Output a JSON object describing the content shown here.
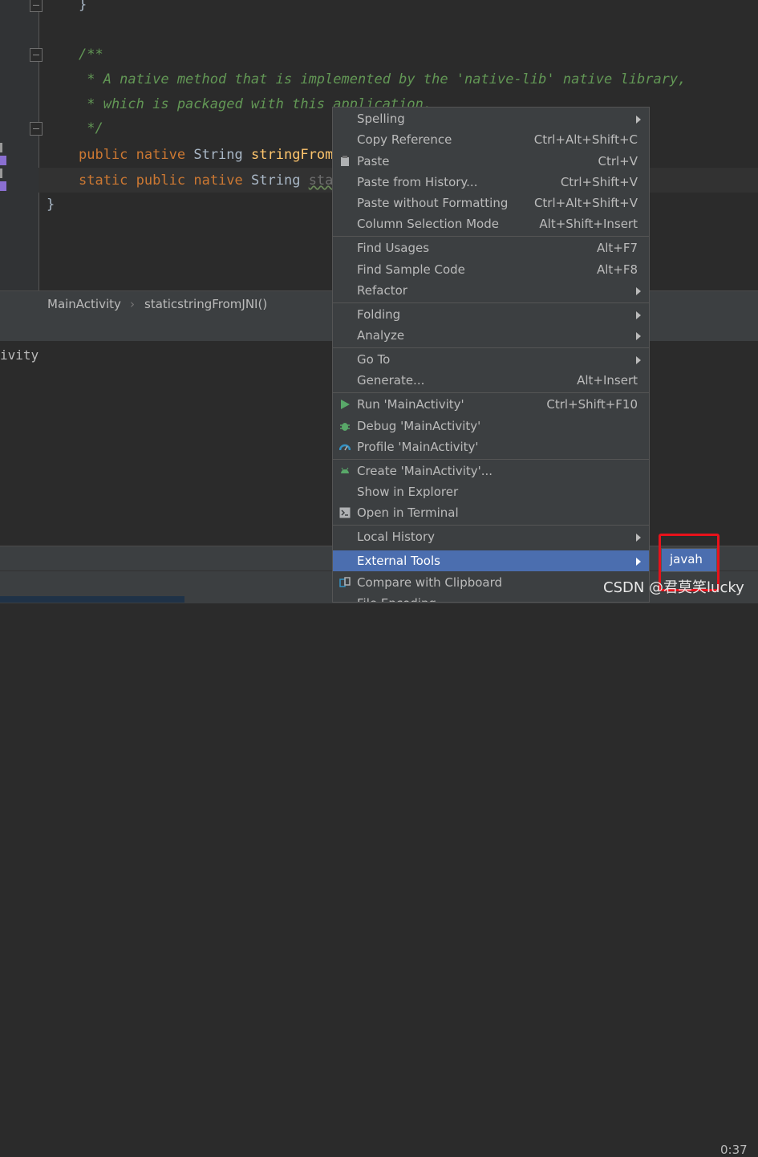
{
  "editor": {
    "line_brace_top": "}",
    "comment_open": "/**",
    "comment_line1": " * A native method that is implemented by the 'native-lib' native library,",
    "comment_line2": " * which is packaged with this application.",
    "comment_close": " */",
    "line1": {
      "kw1": "public",
      "kw2": "native",
      "type": "String",
      "method": "stringFromJ"
    },
    "line2": {
      "kw1": "static",
      "kw2": "public",
      "kw3": "native",
      "type": "String",
      "method": "stat"
    },
    "closing_brace": "}"
  },
  "breadcrumb": {
    "class_name": "MainActivity",
    "separator": "›",
    "method_name": "staticstringFromJNI()"
  },
  "panel": {
    "text_fragment": "ivity"
  },
  "context_menu": {
    "items": [
      {
        "label": "Spelling",
        "shortcut": "",
        "submenu": true
      },
      {
        "label": "Copy Reference",
        "shortcut": "Ctrl+Alt+Shift+C"
      },
      {
        "label": "Paste",
        "shortcut": "Ctrl+V",
        "icon": "paste-icon"
      },
      {
        "label": "Paste from History...",
        "shortcut": "Ctrl+Shift+V"
      },
      {
        "label": "Paste without Formatting",
        "shortcut": "Ctrl+Alt+Shift+V"
      },
      {
        "label": "Column Selection Mode",
        "shortcut": "Alt+Shift+Insert"
      },
      {
        "label": "Find Usages",
        "shortcut": "Alt+F7"
      },
      {
        "label": "Find Sample Code",
        "shortcut": "Alt+F8"
      },
      {
        "label": "Refactor",
        "shortcut": "",
        "submenu": true
      },
      {
        "label": "Folding",
        "shortcut": "",
        "submenu": true
      },
      {
        "label": "Analyze",
        "shortcut": "",
        "submenu": true
      },
      {
        "label": "Go To",
        "shortcut": "",
        "submenu": true
      },
      {
        "label": "Generate...",
        "shortcut": "Alt+Insert"
      },
      {
        "label": "Run 'MainActivity'",
        "shortcut": "Ctrl+Shift+F10",
        "icon": "run-icon"
      },
      {
        "label": "Debug 'MainActivity'",
        "shortcut": "",
        "icon": "debug-icon"
      },
      {
        "label": "Profile 'MainActivity'",
        "shortcut": "",
        "icon": "profile-icon"
      },
      {
        "label": "Create 'MainActivity'...",
        "shortcut": "",
        "icon": "android-icon"
      },
      {
        "label": "Show in Explorer",
        "shortcut": ""
      },
      {
        "label": "Open in Terminal",
        "shortcut": "",
        "icon": "terminal-icon"
      },
      {
        "label": "Local History",
        "shortcut": "",
        "submenu": true
      },
      {
        "label": "External Tools",
        "shortcut": "",
        "submenu": true,
        "selected": true
      },
      {
        "label": "Compare with Clipboard",
        "shortcut": "",
        "icon": "compare-icon"
      },
      {
        "label": "File Encoding",
        "shortcut": ""
      }
    ]
  },
  "submenu": {
    "item": "javah"
  },
  "status": {
    "time_fragment": "0:37"
  },
  "watermark": "CSDN @君莫笑lucky",
  "colors": {
    "selection": "#4b6eaf",
    "highlight_box": "#e8121b",
    "keyword": "#cc7832",
    "comment": "#629755"
  }
}
